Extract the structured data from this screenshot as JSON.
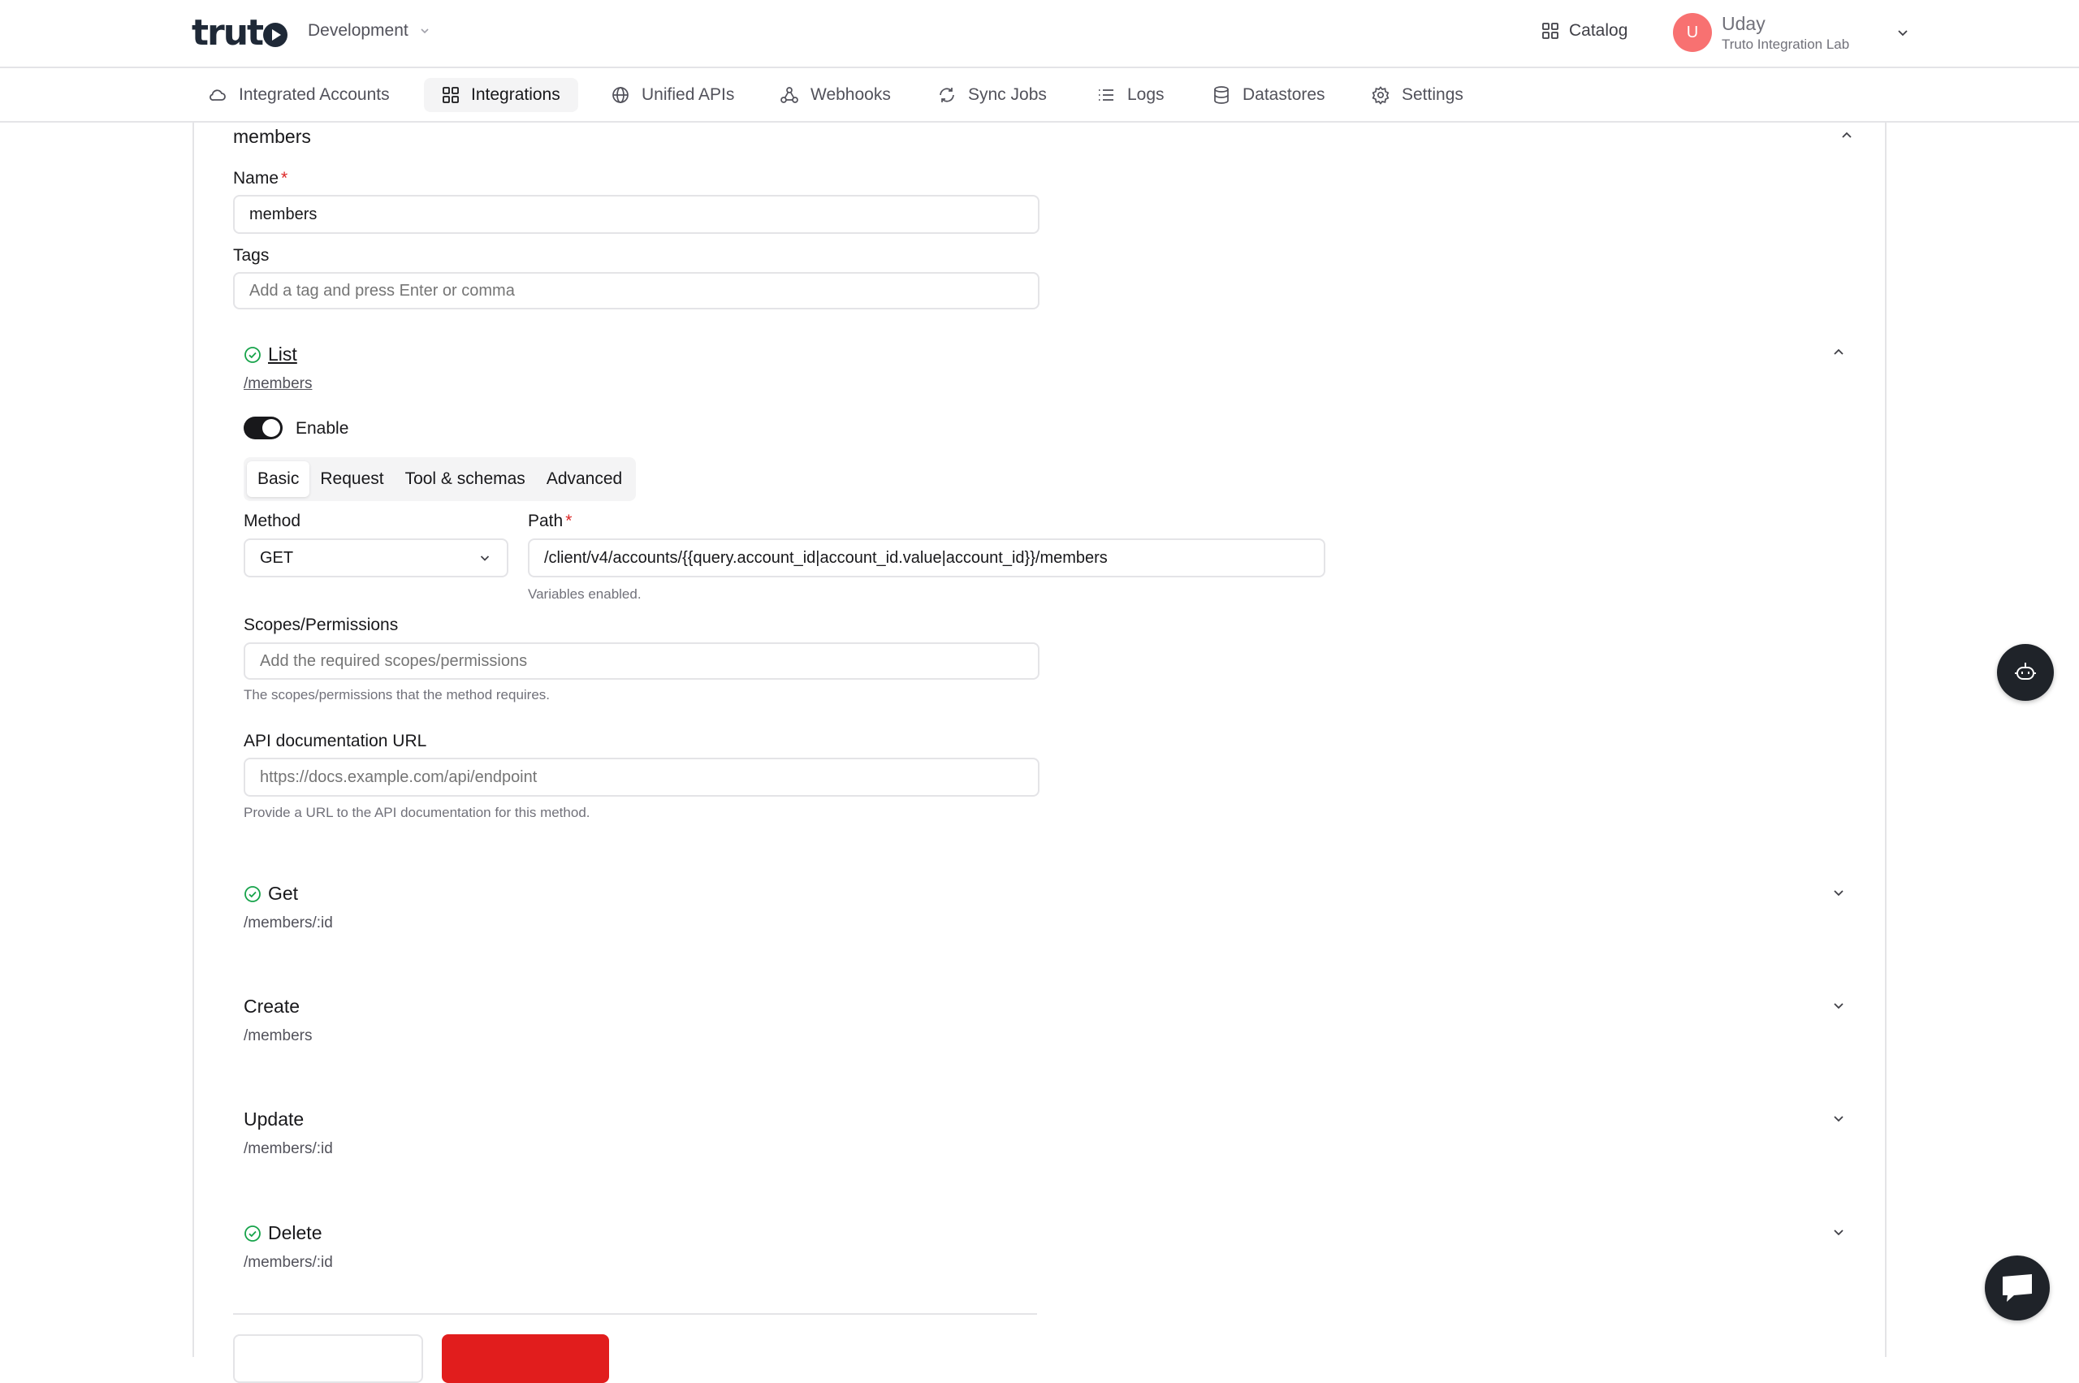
{
  "header": {
    "environment": "Development",
    "catalog_label": "Catalog",
    "user": {
      "initial": "U",
      "name": "Uday",
      "org": "Truto Integration Lab"
    }
  },
  "nav": {
    "items": [
      {
        "label": "Integrated Accounts",
        "icon": "cloud-icon"
      },
      {
        "label": "Integrations",
        "icon": "grid-icon",
        "active": true
      },
      {
        "label": "Unified APIs",
        "icon": "globe-icon"
      },
      {
        "label": "Webhooks",
        "icon": "webhook-icon"
      },
      {
        "label": "Sync Jobs",
        "icon": "sync-icon"
      },
      {
        "label": "Logs",
        "icon": "list-icon"
      },
      {
        "label": "Datastores",
        "icon": "database-icon"
      },
      {
        "label": "Settings",
        "icon": "gear-icon"
      }
    ]
  },
  "resource": {
    "title": "members",
    "name_label": "Name",
    "name_value": "members",
    "tags_label": "Tags",
    "tags_placeholder": "Add a tag and press Enter or comma"
  },
  "methods": {
    "list": {
      "title": "List",
      "path": "/members",
      "enable_label": "Enable",
      "tabs": [
        "Basic",
        "Request",
        "Tool & schemas",
        "Advanced"
      ],
      "method_label": "Method",
      "method_value": "GET",
      "path_label": "Path",
      "path_value": "/client/v4/accounts/{{query.account_id|account_id.value|account_id}}/members",
      "path_helper": "Variables enabled.",
      "scopes_label": "Scopes/Permissions",
      "scopes_placeholder": "Add the required scopes/permissions",
      "scopes_helper": "The scopes/permissions that the method requires.",
      "doc_label": "API documentation URL",
      "doc_placeholder": "https://docs.example.com/api/endpoint",
      "doc_helper": "Provide a URL to the API documentation for this method."
    },
    "get": {
      "title": "Get",
      "path": "/members/:id"
    },
    "create": {
      "title": "Create",
      "path": "/members"
    },
    "update": {
      "title": "Update",
      "path": "/members/:id"
    },
    "delete": {
      "title": "Delete",
      "path": "/members/:id"
    }
  },
  "colors": {
    "accent_green": "#16a34a",
    "danger": "#e11d1d",
    "required": "#dc2626"
  }
}
